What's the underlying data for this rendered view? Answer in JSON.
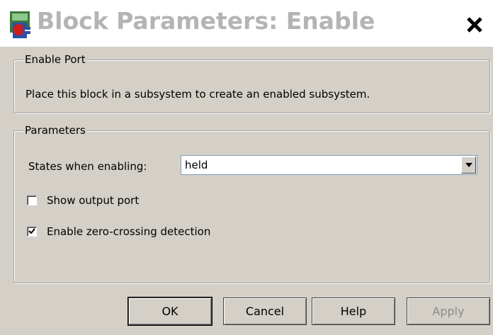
{
  "window": {
    "title": "Block Parameters: Enable",
    "close_glyph": "X"
  },
  "enable_port": {
    "legend": "Enable Port",
    "description": "Place this block in a subsystem to create an enabled subsystem."
  },
  "parameters": {
    "legend": "Parameters",
    "states_label": "States when enabling:",
    "states_value": "held",
    "show_output_port": {
      "label": "Show output port",
      "checked": false
    },
    "zero_crossing": {
      "label": "Enable zero-crossing detection",
      "checked": true
    }
  },
  "buttons": {
    "ok": "OK",
    "cancel": "Cancel",
    "help": "Help",
    "apply": "Apply"
  }
}
